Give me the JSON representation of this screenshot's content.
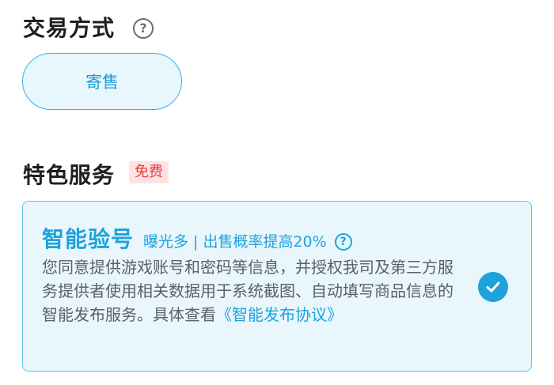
{
  "trade": {
    "title": "交易方式",
    "help_icon": "question-circle-icon",
    "option_label": "寄售"
  },
  "service": {
    "title": "特色服务",
    "badge": "免费",
    "card": {
      "name": "智能验号",
      "tag_part1": "曝光多",
      "separator": "|",
      "tag_part2": "出售概率提高20%",
      "help_icon": "question-circle-icon",
      "description": "您同意提供游戏账号和密码等信息，并授权我司及第三方服务提供者使用相关数据用于系统截图、自动填写商品信息的智能发布服务。具体查看",
      "link_text": "《智能发布协议》",
      "checked": true,
      "check_icon": "check-circle-icon"
    }
  },
  "colors": {
    "accent": "#1ea2dc",
    "pill_bg": "#e8f7fd",
    "badge_bg": "#fde3e3",
    "badge_text": "#ee3b3b"
  }
}
